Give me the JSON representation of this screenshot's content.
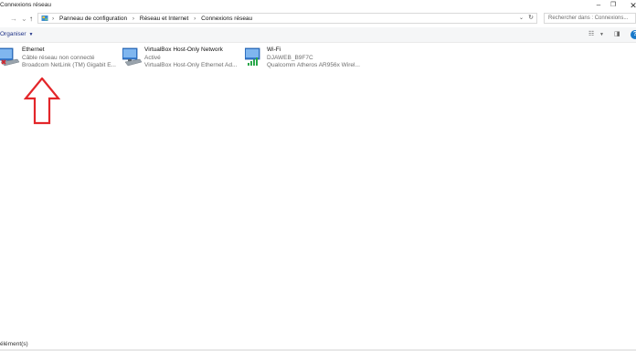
{
  "window": {
    "title": "Connexions réseau"
  },
  "nav": {
    "breadcrumbs": [
      "Panneau de configuration",
      "Réseau et Internet",
      "Connexions réseau"
    ],
    "search_placeholder": "Rechercher dans : Connexions..."
  },
  "toolbar": {
    "organize_label": "Organiser"
  },
  "connections": [
    {
      "name": "Ethernet",
      "status": "Câble réseau non connecté",
      "device": "Broadcom NetLink (TM) Gigabit E...",
      "icon": "network-adapter-disconnected-icon"
    },
    {
      "name": "VirtualBox Host-Only Network",
      "status": "Activé",
      "device": "VirtualBox Host-Only Ethernet Ad...",
      "icon": "network-adapter-icon"
    },
    {
      "name": "Wi-Fi",
      "status": "DJAWEB_B9F7C",
      "device": "Qualcomm Atheros AR956x Wirel...",
      "icon": "wifi-adapter-icon"
    }
  ],
  "statusbar": {
    "count_text": "élément(s)"
  },
  "colors": {
    "accent": "#1979ca",
    "annotation_arrow": "#e3262a"
  }
}
